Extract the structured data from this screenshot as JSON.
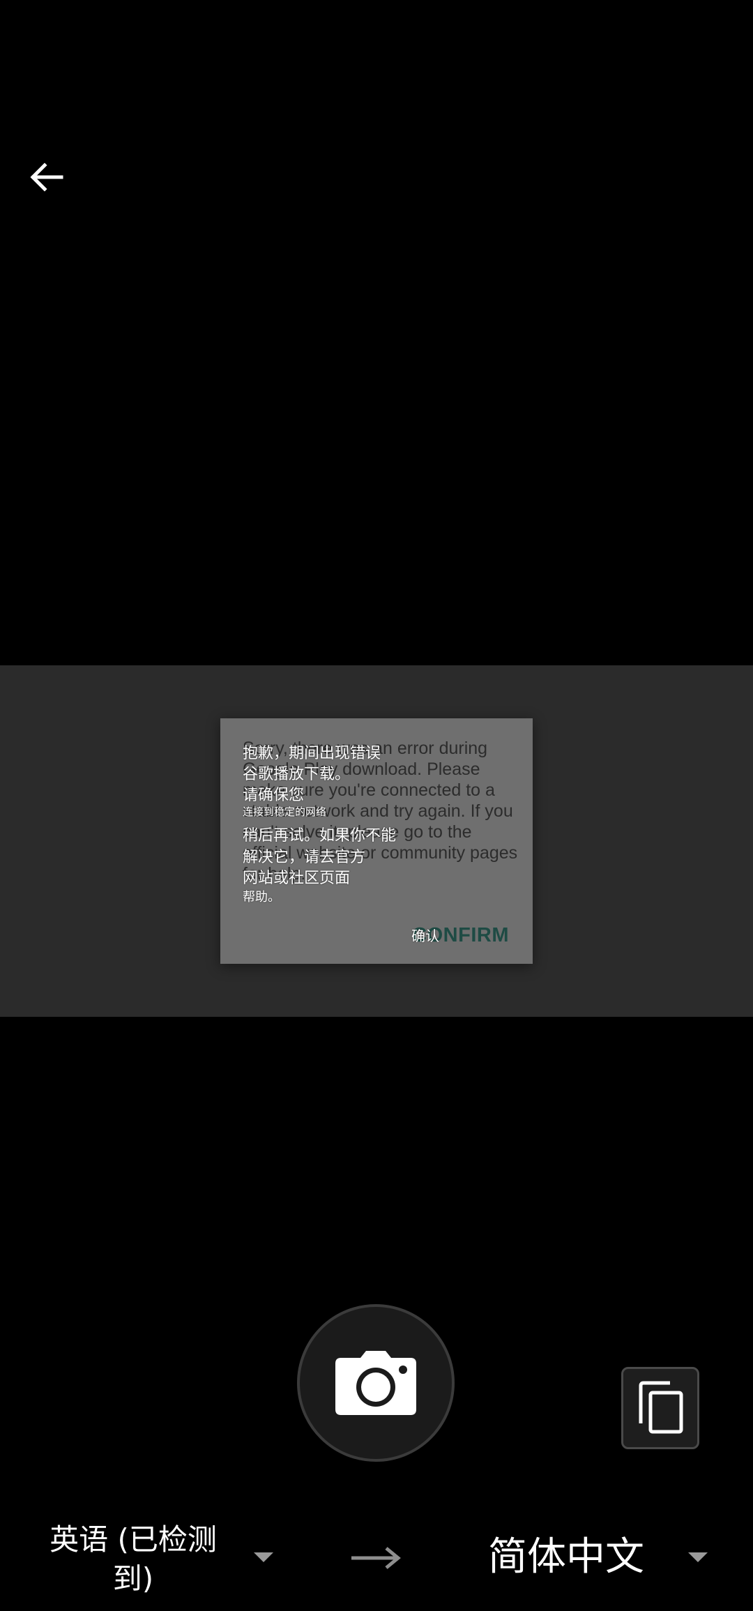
{
  "header": {
    "back_icon": "arrow-left-icon"
  },
  "preview": {
    "original_dialog": {
      "message": "Sorry, there was an error during Google Play download. Please make sure you're connected to a stable network and try again. If you can't solve it, please go to the official website or community pages for help.",
      "confirm_label": "CONFIRM"
    },
    "translated_overlay": {
      "lines": [
        "抱歉，期间出现错误",
        "谷歌播放下载。",
        "请确保您",
        "连接到稳定的网络",
        "稍后再试。如果你不能",
        "解决它，请去官方",
        "网站或社区页面",
        "帮助。"
      ],
      "confirm_label": "确认"
    }
  },
  "controls": {
    "shutter_icon": "camera-icon",
    "gallery_icon": "copy-pages-icon"
  },
  "languages": {
    "source": "英语 (已检测到)",
    "target": "简体中文",
    "dropdown_icon": "caret-down-icon",
    "swap_icon": "arrow-right-icon"
  },
  "colors": {
    "background": "#000000",
    "preview_band": "#2b2b2b",
    "dialog": "#6f6f6f",
    "confirm_accent": "#1e4b44"
  }
}
